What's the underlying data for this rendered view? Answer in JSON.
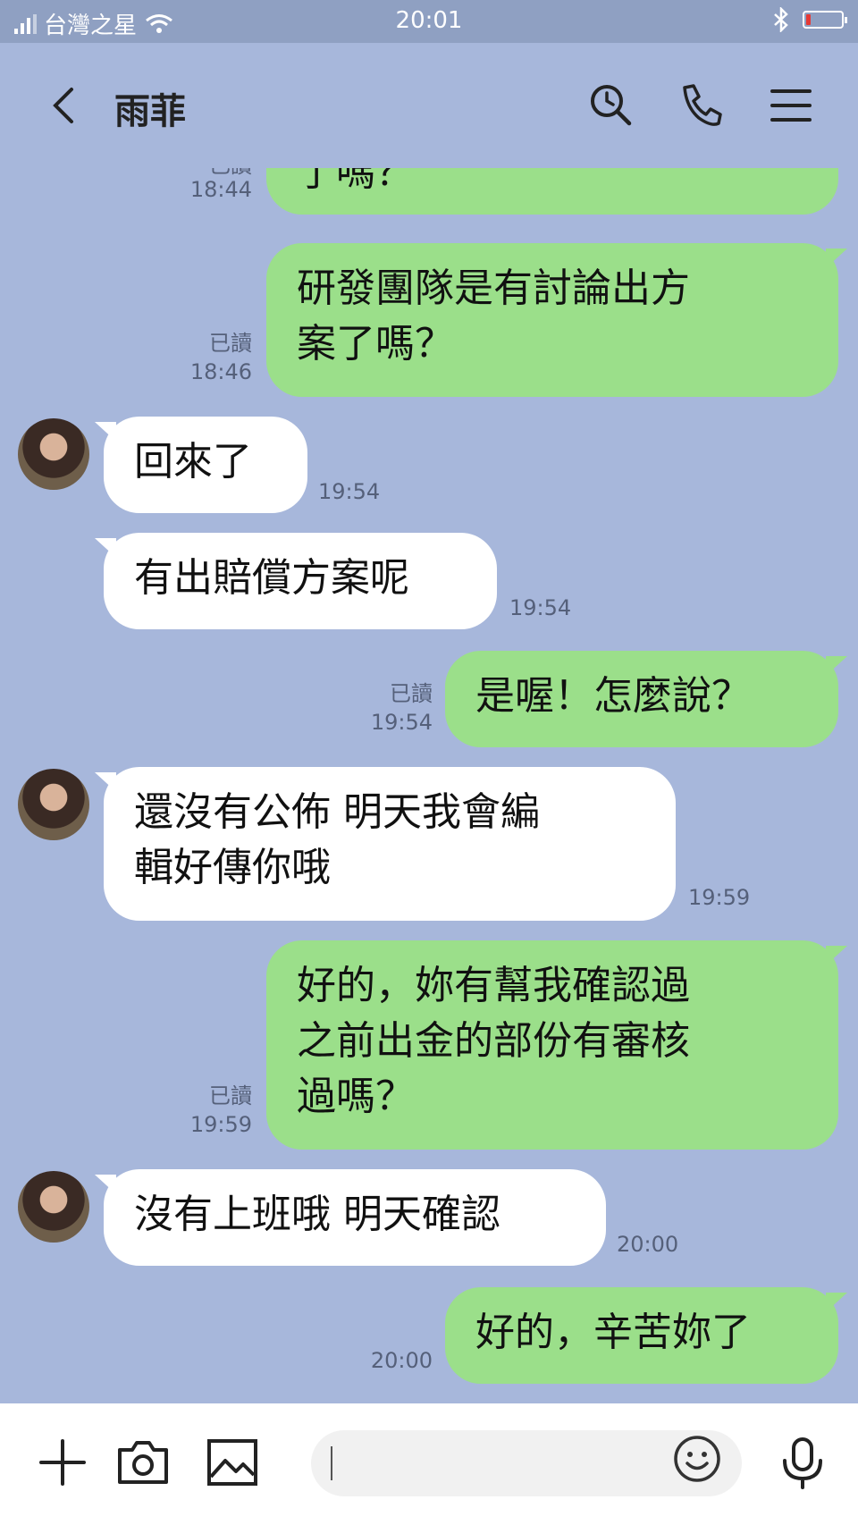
{
  "status_bar": {
    "carrier": "台灣之星",
    "time": "20:01",
    "icons": [
      "signal-icon",
      "wifi-icon",
      "bluetooth-icon",
      "battery-icon"
    ],
    "battery_level": 0.12
  },
  "header": {
    "contact_name": "雨菲",
    "icons": [
      "back-icon",
      "search-icon",
      "phone-icon",
      "menu-icon"
    ]
  },
  "messages": [
    {
      "direction": "out",
      "lines": [
        "了嗎？"
      ],
      "read": "已讀",
      "time": "18:44"
    },
    {
      "direction": "out",
      "lines": [
        "研發團隊是有討論出方",
        "案了嗎？"
      ],
      "read": "已讀",
      "time": "18:46"
    },
    {
      "direction": "in",
      "lines": [
        "回來了"
      ],
      "time": "19:54"
    },
    {
      "direction": "in",
      "lines": [
        "有出賠償方案呢"
      ],
      "time": "19:54"
    },
    {
      "direction": "out",
      "lines": [
        "是喔！怎麼說？"
      ],
      "read": "已讀",
      "time": "19:54"
    },
    {
      "direction": "in",
      "lines": [
        "還沒有公佈  明天我會編",
        "輯好傳你哦"
      ],
      "time": "19:59"
    },
    {
      "direction": "out",
      "lines": [
        "好的，妳有幫我確認過",
        "之前出金的部份有審核",
        "過嗎？"
      ],
      "read": "已讀",
      "time": "19:59"
    },
    {
      "direction": "in",
      "lines": [
        "沒有上班哦 明天確認"
      ],
      "time": "20:00"
    },
    {
      "direction": "out",
      "lines": [
        "好的，辛苦妳了"
      ],
      "time": "20:00"
    }
  ],
  "input_bar": {
    "icons": [
      "plus-icon",
      "camera-icon",
      "image-icon",
      "emoji-icon",
      "microphone-icon"
    ],
    "text_value": ""
  },
  "colors": {
    "background": "#a7b7db",
    "outgoing_bubble": "#9bdf8a",
    "incoming_bubble": "#ffffff",
    "status_bar": "#8fa0c2"
  }
}
